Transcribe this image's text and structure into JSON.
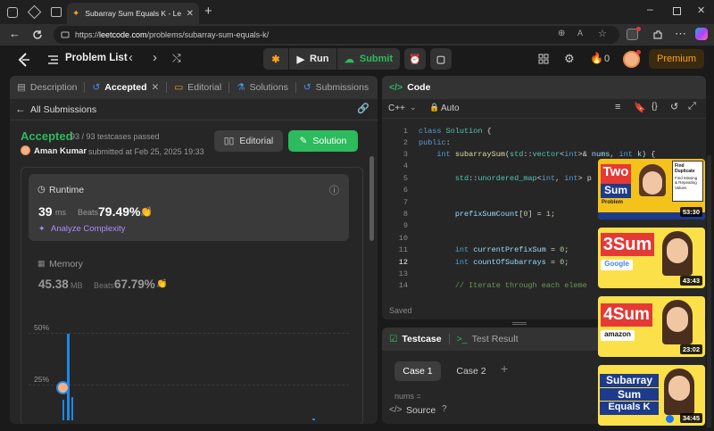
{
  "browser": {
    "tab_title": "Subarray Sum Equals K - LeetCode",
    "url_prefix": "https://",
    "url_host": "leetcode.com",
    "url_path": "/problems/subarray-sum-equals-k/"
  },
  "nav": {
    "problem_list": "Problem List",
    "run": "Run",
    "submit": "Submit",
    "streak": "0",
    "premium": "Premium"
  },
  "left_tabs": {
    "description": "Description",
    "accepted": "Accepted",
    "editorial": "Editorial",
    "solutions": "Solutions",
    "submissions": "Submissions"
  },
  "submission": {
    "back": "All Submissions",
    "status": "Accepted",
    "testcases": "93 / 93 testcases passed",
    "user": "Aman Kumar",
    "submitted": "submitted at Feb 25, 2025 19:33",
    "editorial_btn": "Editorial",
    "solution_btn": "Solution",
    "runtime_label": "Runtime",
    "runtime_value": "39",
    "runtime_unit": "ms",
    "beats_label": "Beats",
    "runtime_beats": "79.49%",
    "analyze": "Analyze Complexity",
    "memory_label": "Memory",
    "memory_value": "45.38",
    "memory_unit": "MB",
    "memory_beats": "67.79%",
    "y_50": "50%",
    "y_25": "25%"
  },
  "code_panel": {
    "title": "Code",
    "lang": "C++",
    "mode": "Auto",
    "saved": "Saved",
    "line_numbers": [
      "1",
      "2",
      "3",
      "4",
      "5",
      "6",
      "7",
      "8",
      "9",
      "10",
      "11",
      "12",
      "13",
      "14"
    ]
  },
  "testcase_panel": {
    "testcase": "Testcase",
    "test_result": "Test Result",
    "case1": "Case 1",
    "case2": "Case 2",
    "nums_label": "nums =",
    "source": "Source"
  },
  "videos": [
    {
      "line1": "Two",
      "line2": "Sum",
      "line3": "Problem",
      "tag": "Find Duplicate",
      "sub": "Find Missing & Repeating Values",
      "duration": "53:30"
    },
    {
      "line1": "3Sum",
      "tag": "Google",
      "duration": "43:43"
    },
    {
      "line1": "4Sum",
      "tag": "amazon",
      "duration": "23:02"
    },
    {
      "line1": "Subarray",
      "line2": "Sum",
      "line3": "Equals K",
      "duration": "34:45"
    }
  ],
  "colors": {
    "accent_green": "#2cbb5d",
    "premium": "#ffa116"
  }
}
